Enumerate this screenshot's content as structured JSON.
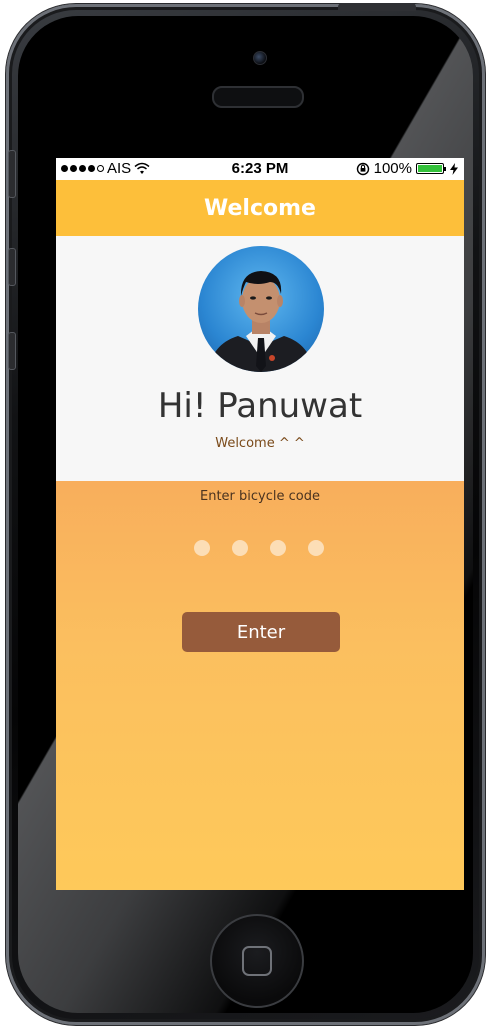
{
  "status_bar": {
    "carrier": "AIS",
    "time": "6:23 PM",
    "battery_percent": "100%",
    "battery_level": 1.0,
    "signal_bars_filled": 4,
    "signal_bars_total": 5,
    "icons": [
      "signal-icon",
      "wifi-icon",
      "rotation-lock-icon",
      "battery-icon",
      "charging-icon"
    ]
  },
  "nav": {
    "title": "Welcome"
  },
  "profile": {
    "greeting": "Hi! Panuwat",
    "sub_greeting": "Welcome ^ ^",
    "avatar": "profile-photo"
  },
  "code_entry": {
    "label": "Enter bicycle code",
    "digits_total": 4,
    "digits_entered": 0,
    "button_label": "Enter"
  },
  "colors": {
    "nav_bar": "#fdbf3a",
    "profile_background": "#f7f7f7",
    "gradient_top": "#f8ae5c",
    "gradient_bottom": "#fec95a",
    "button": "#965b3b",
    "battery": "#34c13a"
  }
}
